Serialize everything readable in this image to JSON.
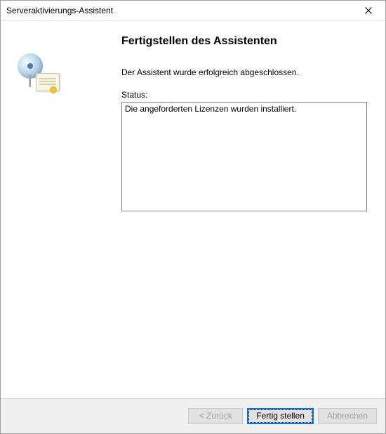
{
  "window": {
    "title": "Serveraktivierungs-Assistent"
  },
  "main": {
    "heading": "Fertigstellen des Assistenten",
    "completion_message": "Der Assistent wurde erfolgreich abgeschlossen.",
    "status_label": "Status:",
    "status_text": "Die angeforderten Lizenzen wurden installiert."
  },
  "buttons": {
    "back": "< Zurück",
    "finish": "Fertig stellen",
    "cancel": "Abbrechen"
  }
}
